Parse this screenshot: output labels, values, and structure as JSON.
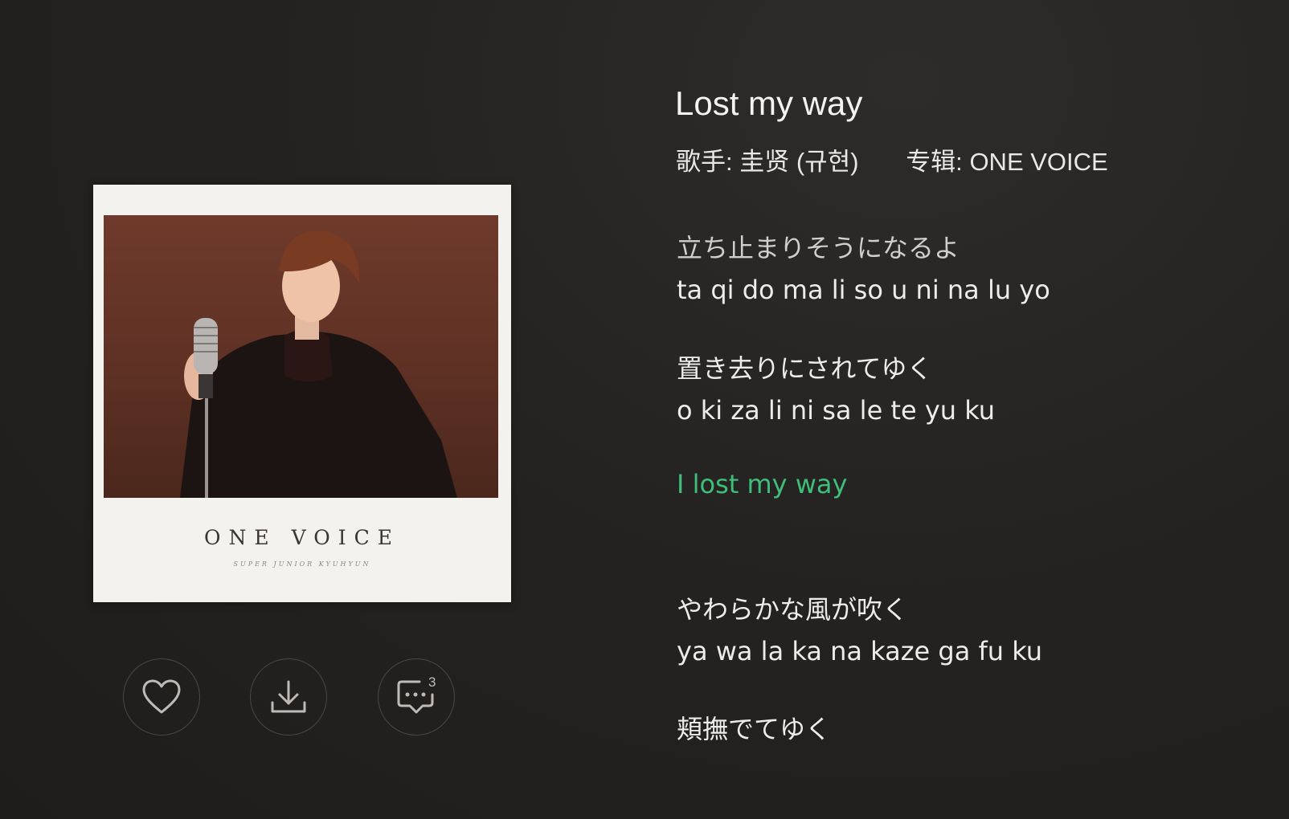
{
  "song": {
    "title": "Lost my way",
    "singer_label": "歌手:",
    "singer": "圭贤 (규현)",
    "album_label": "专辑:",
    "album": "ONE VOICE"
  },
  "album_art": {
    "title_text": "ONE VOICE",
    "subtitle_text": "SUPER JUNIOR KYUHYUN"
  },
  "actions": {
    "like_icon": "heart-icon",
    "download_icon": "download-icon",
    "comment_icon": "comment-icon",
    "comment_count": "3"
  },
  "lyrics": [
    {
      "text": "立ち止まりそうになるよ",
      "state": "dim"
    },
    {
      "text": "ta qi do ma li so u ni na lu yo",
      "state": "normal"
    },
    {
      "text": "置き去りにされてゆく",
      "state": "normal"
    },
    {
      "text": "o ki za li ni sa le te yu ku",
      "state": "normal"
    },
    {
      "text": "I lost my way",
      "state": "active"
    },
    {
      "text": "やわらかな風が吹く",
      "state": "normal"
    },
    {
      "text": "ya wa la ka na kaze ga fu ku",
      "state": "normal"
    },
    {
      "text": "頬撫でてゆく",
      "state": "normal"
    }
  ],
  "colors": {
    "active_lyric": "#3fbe7a",
    "background": "#252321"
  }
}
